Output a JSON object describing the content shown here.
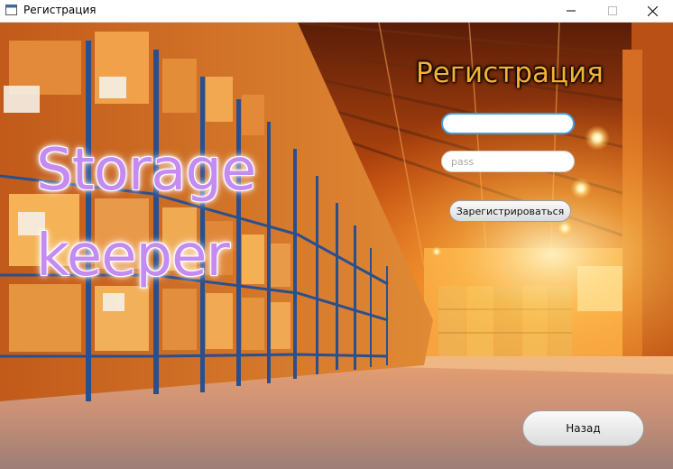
{
  "window": {
    "title": "Регистрация",
    "controls": {
      "minimize": "minimize-icon",
      "maximize": "maximize-icon",
      "close": "close-icon"
    }
  },
  "brand": {
    "line1": "Storage",
    "line2": "keeper"
  },
  "form": {
    "title": "Регистрация",
    "login": {
      "value": "",
      "placeholder": ""
    },
    "password": {
      "value": "",
      "placeholder": "pass"
    },
    "register_label": "Зарегистрироваться"
  },
  "back_label": "Назад",
  "colors": {
    "accent_focus": "#3aa0e8",
    "brand_text": "#c48cf2",
    "title_text": "#f5b133"
  }
}
